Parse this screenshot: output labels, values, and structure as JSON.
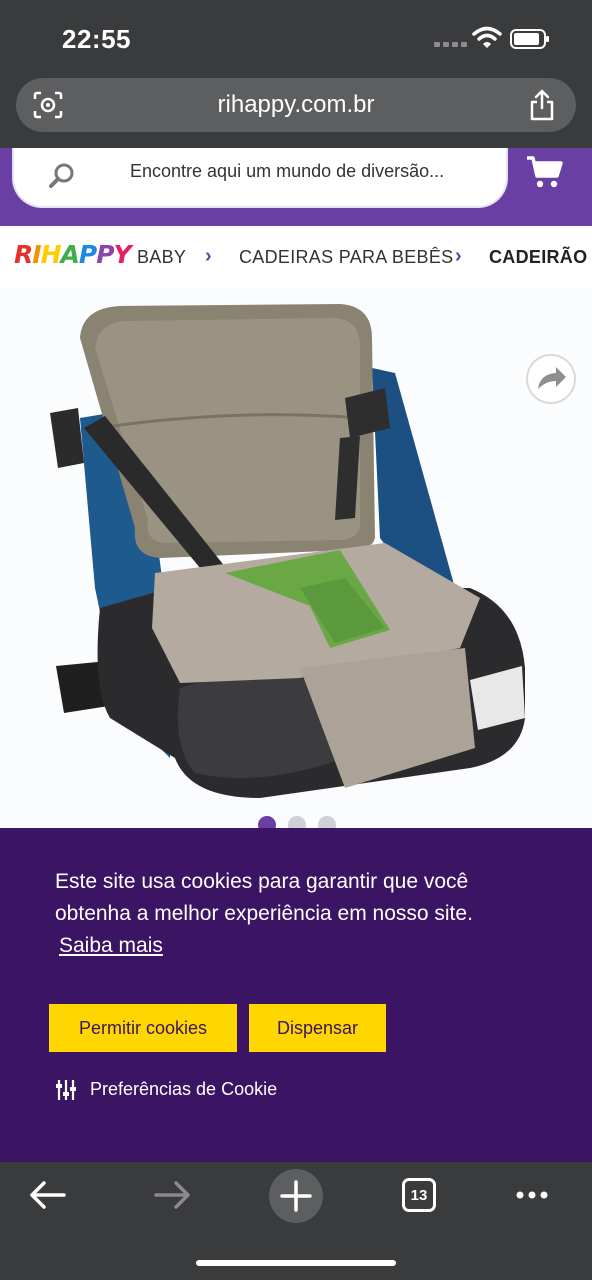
{
  "status_bar": {
    "time": "22:55"
  },
  "browser": {
    "url": "rihappy.com.br",
    "tab_count": "13"
  },
  "site": {
    "search_placeholder": "Encontre aqui um mundo de diversão...",
    "logo_text": "RIHAPPY"
  },
  "breadcrumb": {
    "items": [
      "BABY",
      "CADEIRAS PARA BEBÊS",
      "CADEIRÃO"
    ]
  },
  "carousel": {
    "dot_count": 3,
    "active_index": 0
  },
  "cookie_banner": {
    "message": "Este site usa cookies para garantir que você obtenha a melhor experiência em nosso site.",
    "learn_more": "Saiba mais",
    "allow_label": "Permitir cookies",
    "dismiss_label": "Dispensar",
    "preferences_label": "Preferências de Cookie"
  },
  "colors": {
    "header_purple": "#6a3fa4",
    "banner_purple": "#3b1464",
    "button_yellow": "#ffd700",
    "chrome_dark": "#3a3b3d"
  },
  "icons": [
    "lens-icon",
    "share-icon",
    "search-icon",
    "cart-icon",
    "share-arrow-icon",
    "back-arrow-icon",
    "forward-arrow-icon",
    "plus-icon",
    "tabs-icon",
    "more-icon",
    "sliders-icon"
  ]
}
